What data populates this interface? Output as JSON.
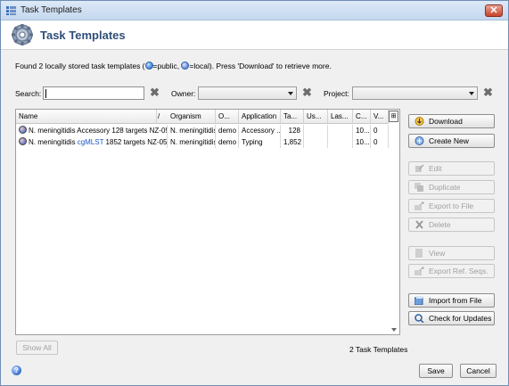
{
  "window": {
    "title": "Task Templates",
    "close_label": "✕"
  },
  "header": {
    "title": "Task Templates"
  },
  "info": {
    "prefix": "Found 2 locally stored task templates (",
    "public_label": "=public, ",
    "local_label": "=local). Press 'Download' to retrieve more."
  },
  "filters": {
    "search_label": "Search:",
    "owner_label": "Owner:",
    "project_label": "Project:",
    "clear_glyph": "✖"
  },
  "table": {
    "columns": [
      "Name",
      "/",
      "Organism",
      "O...",
      "Application",
      "Ta...",
      "Us...",
      "Las...",
      "C...",
      "V..."
    ],
    "rows": [
      {
        "name_pre": "N. meningitidis Accessory 128 targets NZ-05/33",
        "name_hi": "",
        "name_post": "",
        "organism": "N. meningitidis",
        "owner": "demo",
        "application": "Accessory ...",
        "targets": "128",
        "used": "",
        "last": "",
        "created": "10...",
        "version": "0"
      },
      {
        "name_pre": "N. meningitidis ",
        "name_hi": "cgMLST",
        "name_post": " 1852 targets NZ-05/33",
        "organism": "N. meningitidis",
        "owner": "demo",
        "application": "Typing",
        "targets": "1,852",
        "used": "",
        "last": "",
        "created": "10...",
        "version": "0"
      }
    ],
    "column_selector": "⊞"
  },
  "actions": {
    "download": "Download",
    "create_new": "Create New",
    "edit": "Edit",
    "duplicate": "Duplicate",
    "export_to_file": "Export to File",
    "delete": "Delete",
    "view": "View",
    "export_ref_seqs": "Export Ref. Seqs.",
    "import_from_file": "Import from File",
    "check_for_updates": "Check for Updates"
  },
  "footer": {
    "show_all": "Show All",
    "count": "2 Task Templates",
    "save": "Save",
    "cancel": "Cancel",
    "help": "?"
  },
  "colors": {
    "header_title": "#2f4f78",
    "highlight": "#1f57c4",
    "close": "#c8422b"
  },
  "icons": [
    "app-icon",
    "gear-icon",
    "globe-icon",
    "download-icon",
    "create-icon",
    "edit-icon",
    "duplicate-icon",
    "export-icon",
    "delete-icon",
    "view-icon",
    "import-icon",
    "update-icon",
    "help-icon",
    "column-selector-icon"
  ]
}
